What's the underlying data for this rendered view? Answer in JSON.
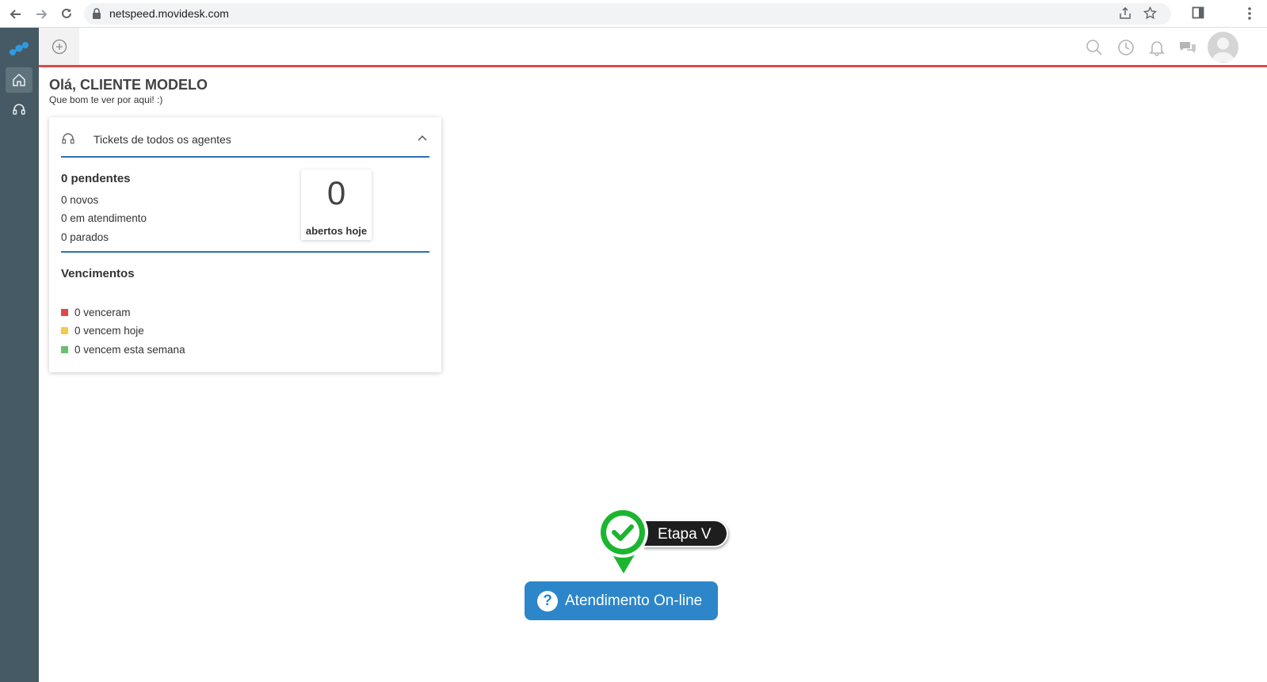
{
  "browser": {
    "url": "netspeed.movidesk.com"
  },
  "header": {
    "icons": [
      "add-icon",
      "search-icon",
      "history-icon",
      "bell-icon",
      "chat-icon",
      "avatar"
    ]
  },
  "sidebar": {
    "items": [
      {
        "icon": "movidesk-logo"
      },
      {
        "icon": "home-icon",
        "active": true
      },
      {
        "icon": "headset-icon",
        "active": false
      }
    ]
  },
  "greeting": {
    "title": "Olá, CLIENTE MODELO",
    "subtitle": "Que bom te ver por aqui! :)"
  },
  "card": {
    "title": "Tickets de todos os agentes",
    "pending_title": "0 pendentes",
    "pending_rows": [
      "0 novos",
      "0 em atendimento",
      "0 parados"
    ],
    "today_count": "0",
    "today_label": "abertos hoje",
    "due_title": "Vencimentos",
    "due_rows": [
      {
        "text": "0 venceram",
        "color": "#e04848"
      },
      {
        "text": "0 vencem hoje",
        "color": "#f5c94a"
      },
      {
        "text": "0 vencem esta semana",
        "color": "#6bbf74"
      }
    ]
  },
  "widget": {
    "step_label": "Etapa V",
    "button_label": "Atendimento On-line",
    "button_icon": "?"
  },
  "colors": {
    "sidebar": "#455a64",
    "header_accent": "#e04848",
    "card_accent": "#2d6fb7",
    "button": "#2c86c9",
    "pin": "#1bb52f"
  }
}
